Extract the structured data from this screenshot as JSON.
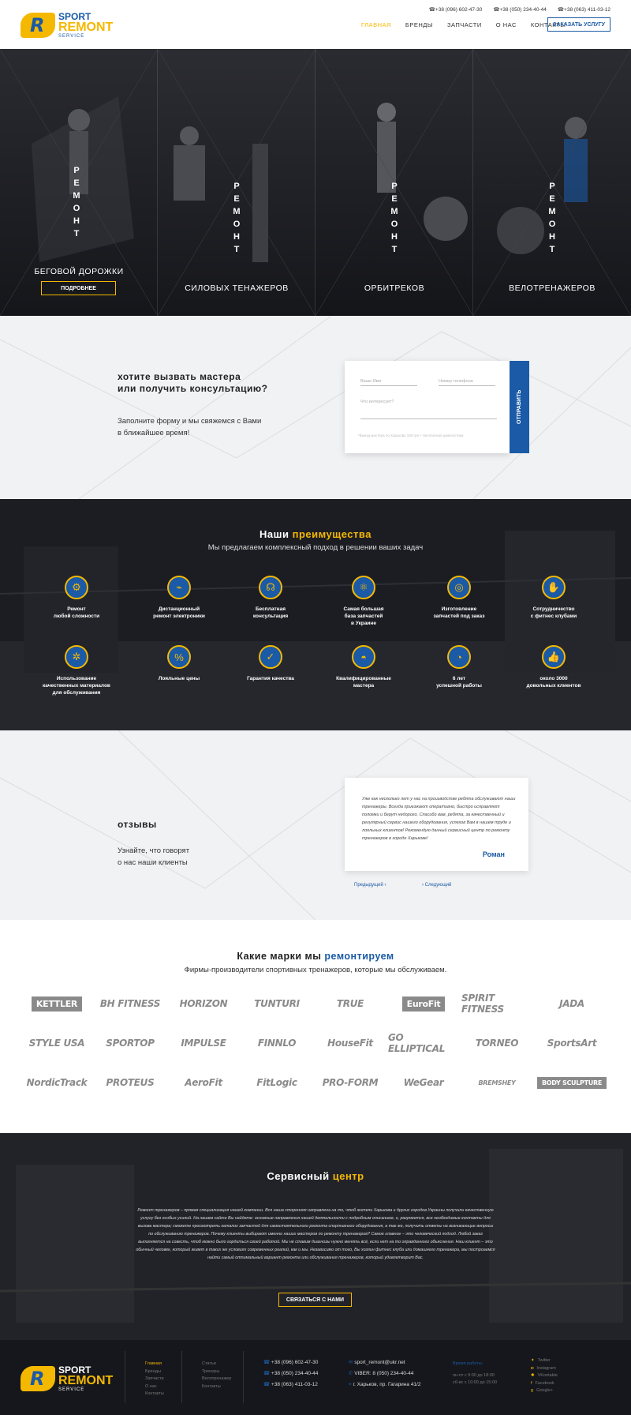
{
  "header": {
    "logo": {
      "line1": "SPORT",
      "line2": "REMONT",
      "line3": "SERVICE"
    },
    "phones": [
      "+38 (096) 602-47-30",
      "+38 (050) 234-40-44",
      "+38 (063) 411-03-12"
    ],
    "nav": [
      "ГЛАВНАЯ",
      "БРЕНДЫ",
      "ЗАПЧАСТИ",
      "О НАС",
      "КОНТАКТЫ"
    ],
    "order_button": "ЗАКАЗАТЬ УСЛУГУ"
  },
  "hero": {
    "repair_word": "РЕМОНТ",
    "panels": [
      {
        "caption": "БЕГОВОЙ ДОРОЖКИ"
      },
      {
        "caption": "СИЛОВЫХ ТЕНАЖЕРОВ"
      },
      {
        "caption": "ОРБИТРЕКОВ"
      },
      {
        "caption": "ВЕЛОТРЕНАЖЕРОВ"
      }
    ],
    "more_button": "ПОДРОБНЕЕ"
  },
  "consult": {
    "title_line1": "хотите вызвать мастера",
    "title_line2": "или получить консультацию?",
    "sub_line1": "Заполните форму и мы свяжемся с Вами",
    "sub_line2": "в ближайшее время!",
    "name_placeholder": "Ваше Имя",
    "phone_placeholder": "Номер телефона",
    "interest_placeholder": "Что интересует?",
    "note": "*Выезд мастера по Харькову 150 грн + бесплатная диагностика",
    "send_button": "ОТПРАВИТЬ"
  },
  "advantages": {
    "title_a": "Наши ",
    "title_b": "преимущества",
    "subtitle": "Мы предлагаем комплексный подход в решении ваших задач",
    "items": [
      {
        "l1": "Ремонт",
        "l2": "любой сложности",
        "l3": "",
        "icon": "gear-icon"
      },
      {
        "l1": "Дистанционный",
        "l2": "ремонт электроники",
        "l3": "",
        "icon": "satellite-icon"
      },
      {
        "l1": "Бесплатная",
        "l2": "консультация",
        "l3": "",
        "icon": "headset-icon"
      },
      {
        "l1": "Самая большая",
        "l2": "база запчастей",
        "l3": "в Украине",
        "icon": "parts-icon"
      },
      {
        "l1": "Изготовление",
        "l2": "запчастей под заказ",
        "l3": "",
        "icon": "coil-icon"
      },
      {
        "l1": "Сотрудничество",
        "l2": "с фитнес клубами",
        "l3": "",
        "icon": "handshake-icon"
      },
      {
        "l1": "Использование",
        "l2": "качественных материалов",
        "l3": "для обслуживания",
        "icon": "cog-icon"
      },
      {
        "l1": "Лояльные цены",
        "l2": "",
        "l3": "",
        "icon": "tag-icon"
      },
      {
        "l1": "Гарантия качества",
        "l2": "",
        "l3": "",
        "icon": "certificate-icon"
      },
      {
        "l1": "Квалифицированные",
        "l2": "мастера",
        "l3": "",
        "icon": "helmet-icon"
      },
      {
        "l1": "6 лет",
        "l2": "успешной работы",
        "l3": "",
        "icon": "speedometer-icon"
      },
      {
        "l1": "около 3000",
        "l2": "довольных клиентов",
        "l3": "",
        "icon": "thumbs-up-icon"
      }
    ]
  },
  "reviews": {
    "title": "отзывы",
    "sub_line1": "Узнайте, что говорят",
    "sub_line2": "о нас наши клиенты",
    "text": "Уже как несколько лет у нас на производстве ребята обслуживают наши тренажеры. Всегда приезжают оперативно, быстро исправляют поломки и берут недорого. Спасибо вам, ребята, за качественный и регулярный сервис нашего оборудования, успехов Вам в нашем труде и лояльных клиентов! Рекомендую данный сервисный центр по ремонту тренажеров в городе Харькове!",
    "author": "Роман",
    "prev": "Предыдущий",
    "next": "Следующий"
  },
  "brands": {
    "title_a": "Какие марки мы ",
    "title_b": "ремонтируем",
    "subtitle": "Фирмы-производители спортивных тренажеров, которые мы обслуживаем.",
    "logos": [
      "KETTLER",
      "BH FITNESS",
      "HORIZON",
      "TUNTURI",
      "TRUE",
      "EuroFit",
      "SPIRIT FITNESS",
      "JADA",
      "STYLE USA",
      "SPORTOP",
      "IMPULSE",
      "FINNLO",
      "HouseFit",
      "GO ELLIPTICAL",
      "TORNEO",
      "SportsArt",
      "NordicTrack",
      "PROTEUS",
      "AeroFit",
      "FitLogic",
      "PRO-FORM",
      "WeGear",
      "BREMSHEY",
      "BODY SCULPTURE"
    ]
  },
  "service": {
    "title_a": "Сервисный ",
    "title_b": "центр",
    "text": "Ремонт тренажеров – прямая специализация нашей компании. Вся наша сторонняя направлена на то, чтоб жители Харькова и других городов Украины получили качественную услугу без особых усилий. На нашем сайте Вы найдете: основные направления нашей деятельности с подробным описанием, и, разумеется, все необходимые контакты для вызова мастера; сможете просмотреть каталог запчастей для самостоятельного ремонта спортивного оборудования, а так же, получить ответы на возникающие вопросы по обслуживанию тренажеров. Почему клиенты выбирают именно наших мастеров по ремонту тренажеров? Самое главное – это человеческий подход. Любой заказ выполняется на совесть, чтоб можно было гордиться своей работой. Мы не ставим диагнозы нужно менять всё, если нет на то оправданного объяснения. Наш клиент – это обычный человек, который живет в таких же условиях современных реалий, как и мы. Независимо от того, Вы хозяин фитнес клуба или домашнего тренажера, мы построаемся найти самый оптимальный вариант ремонта или обслуживания тренажеров, который удовлетворит Вас.",
    "button": "СВЯЗАТЬСЯ С НАМИ"
  },
  "footer": {
    "menu1": [
      "Главная",
      "Бренды",
      "Запчасти",
      "О нас",
      "Контакты"
    ],
    "menu2": [
      "Статьи",
      "Тренеры",
      "Велотренажер",
      "Контакты"
    ],
    "phones": [
      "+38 (096) 602-47-30",
      "+38 (050) 234-40-44",
      "+38 (063) 411-03-12"
    ],
    "email": "sport_remont@ukr.net",
    "viber": "VIBER: 8 (050) 234-40-44",
    "address": "г. Харьков, пр. Гагарина 41/2",
    "hours_title": "Время работы:",
    "hours1": "пн-пт с 9:00 до 18:00",
    "hours2": "сб-вс с 10:00 до 15:00",
    "social": [
      "Twitter",
      "Instagram",
      "VKontakte",
      "Facebook",
      "Google+"
    ]
  }
}
